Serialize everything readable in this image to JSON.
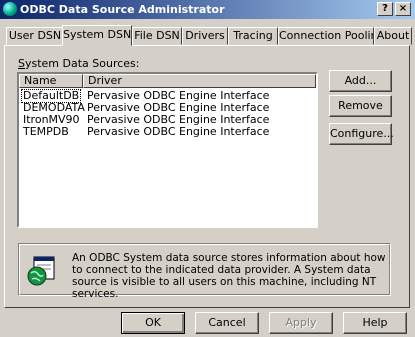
{
  "window": {
    "title": "ODBC Data Source Administrator",
    "help_glyph": "?",
    "close_glyph": "×"
  },
  "tabs": [
    "User DSN",
    "System DSN",
    "File DSN",
    "Drivers",
    "Tracing",
    "Connection Pooling",
    "About"
  ],
  "active_tab": "System DSN",
  "list": {
    "label": "System Data Sources:",
    "columns": [
      "Name",
      "Driver"
    ],
    "rows": [
      {
        "name": "DefaultDB",
        "driver": "Pervasive ODBC Engine Interface"
      },
      {
        "name": "DEMODATA",
        "driver": "Pervasive ODBC Engine Interface"
      },
      {
        "name": "ItronMV90",
        "driver": "Pervasive ODBC Engine Interface"
      },
      {
        "name": "TEMPDB",
        "driver": "Pervasive ODBC Engine Interface"
      }
    ],
    "selected": "DefaultDB"
  },
  "side_buttons": {
    "add": "Add...",
    "remove": "Remove",
    "configure": "Configure..."
  },
  "info": {
    "text": "An ODBC System data source stores information about how to connect to the indicated data provider.  A System data source is visible to all users on this machine, including NT services.",
    "icon": "odbc-globe-icon"
  },
  "footer_buttons": {
    "ok": "OK",
    "cancel": "Cancel",
    "apply": "Apply",
    "help": "Help"
  },
  "colors": {
    "titlebar_start": "#0a246a",
    "titlebar_end": "#a6caf0",
    "face": "#d4d0c8"
  }
}
